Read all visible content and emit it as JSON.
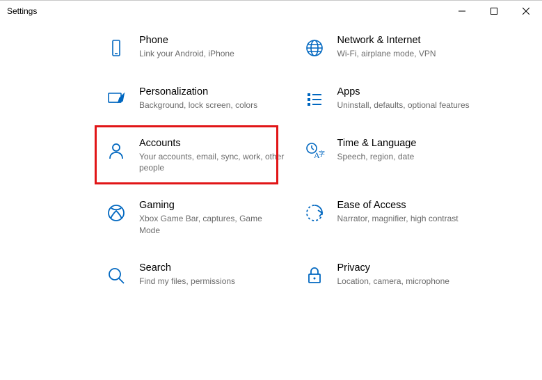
{
  "window": {
    "title": "Settings"
  },
  "tiles": {
    "phone": {
      "title": "Phone",
      "desc": "Link your Android, iPhone"
    },
    "network": {
      "title": "Network & Internet",
      "desc": "Wi-Fi, airplane mode, VPN"
    },
    "personalize": {
      "title": "Personalization",
      "desc": "Background, lock screen, colors"
    },
    "apps": {
      "title": "Apps",
      "desc": "Uninstall, defaults, optional features"
    },
    "accounts": {
      "title": "Accounts",
      "desc": "Your accounts, email, sync, work, other people"
    },
    "time": {
      "title": "Time & Language",
      "desc": "Speech, region, date"
    },
    "gaming": {
      "title": "Gaming",
      "desc": "Xbox Game Bar, captures, Game Mode"
    },
    "ease": {
      "title": "Ease of Access",
      "desc": "Narrator, magnifier, high contrast"
    },
    "search": {
      "title": "Search",
      "desc": "Find my files, permissions"
    },
    "privacy": {
      "title": "Privacy",
      "desc": "Location, camera, microphone"
    }
  },
  "highlight": {
    "target": "accounts"
  }
}
